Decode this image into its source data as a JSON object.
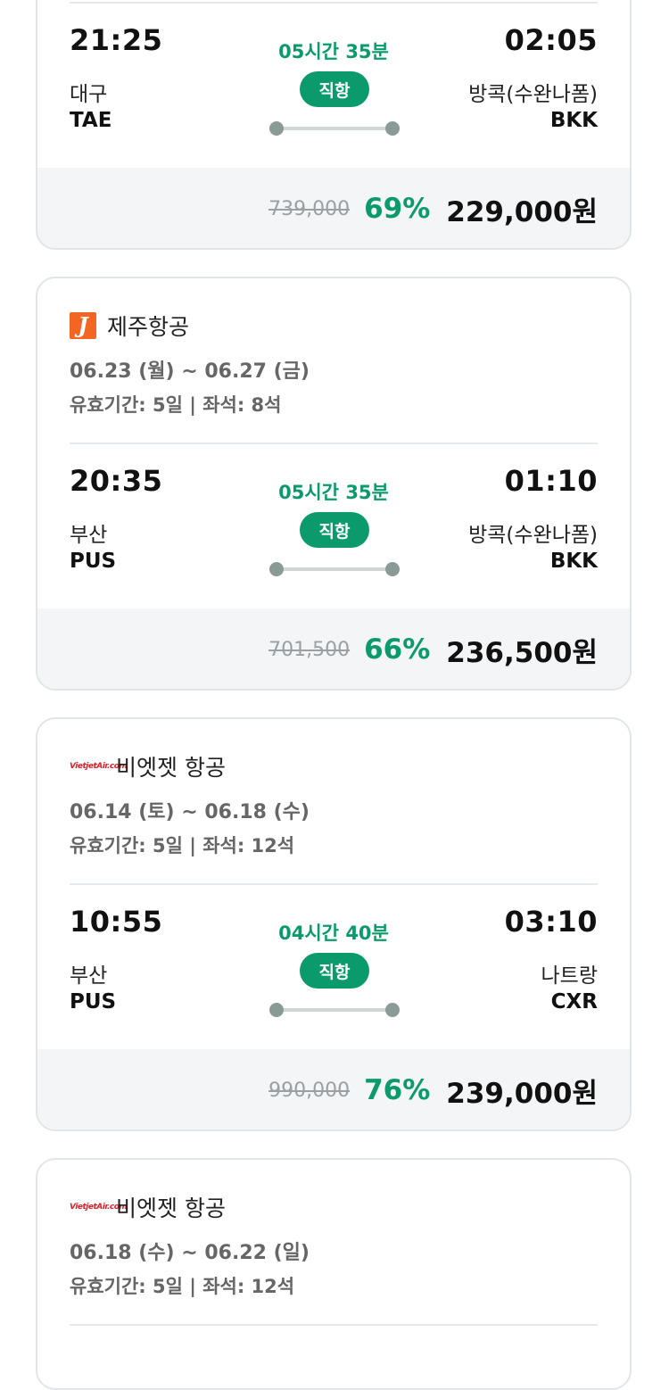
{
  "cards": [
    {
      "flight": {
        "dep_time": "21:25",
        "dep_city": "대구",
        "dep_code": "TAE",
        "duration": "05시간 35분",
        "badge": "직항",
        "arr_time": "02:05",
        "arr_city": "방콕(수완나폼)",
        "arr_code": "BKK"
      },
      "price": {
        "original": "739,000",
        "discount": "69%",
        "final": "229,000원"
      }
    },
    {
      "airline": {
        "name": "제주항공",
        "logo": "jeju-air-logo",
        "logo_text": "J"
      },
      "dates": "06.23 (월) ~ 06.27 (금)",
      "meta": "유효기간: 5일 | 좌석: 8석",
      "flight": {
        "dep_time": "20:35",
        "dep_city": "부산",
        "dep_code": "PUS",
        "duration": "05시간 35분",
        "badge": "직항",
        "arr_time": "01:10",
        "arr_city": "방콕(수완나폼)",
        "arr_code": "BKK"
      },
      "price": {
        "original": "701,500",
        "discount": "66%",
        "final": "236,500원"
      }
    },
    {
      "airline": {
        "name": "비엣젯 항공",
        "logo": "vietjet-logo",
        "logo_text": "VietjetAir.com"
      },
      "dates": "06.14 (토) ~ 06.18 (수)",
      "meta": "유효기간: 5일 | 좌석: 12석",
      "flight": {
        "dep_time": "10:55",
        "dep_city": "부산",
        "dep_code": "PUS",
        "duration": "04시간 40분",
        "badge": "직항",
        "arr_time": "03:10",
        "arr_city": "나트랑",
        "arr_code": "CXR"
      },
      "price": {
        "original": "990,000",
        "discount": "76%",
        "final": "239,000원"
      }
    },
    {
      "airline": {
        "name": "비엣젯 항공",
        "logo": "vietjet-logo",
        "logo_text": "VietjetAir.com"
      },
      "dates": "06.18 (수) ~ 06.22 (일)",
      "meta": "유효기간: 5일 | 좌석: 12석"
    }
  ],
  "colors": {
    "accent": "#0a9a6c",
    "price_bg": "#f4f5f6",
    "border": "#e2e5e8"
  }
}
